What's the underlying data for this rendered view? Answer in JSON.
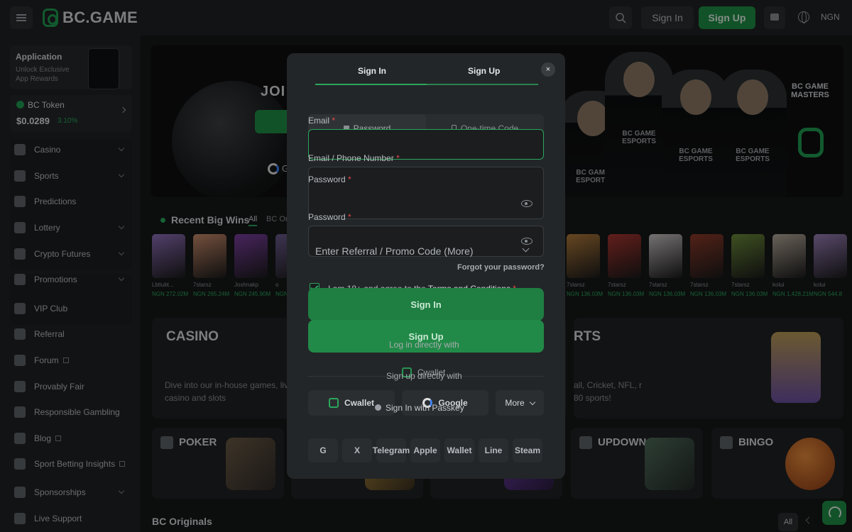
{
  "header": {
    "brand": "BC.GAME",
    "signin_label": "Sign In",
    "signup_label": "Sign Up",
    "currency": "NGN"
  },
  "sidebar": {
    "app_title": "Application",
    "app_sub": "Unlock Exclusive App Rewards",
    "token_name": "BC Token",
    "token_price": "$0.0289",
    "token_change": "3.10%",
    "items": [
      {
        "label": "Casino",
        "icon": "casino-icon",
        "chevron": true
      },
      {
        "label": "Sports",
        "icon": "sports-icon",
        "chevron": true
      },
      {
        "label": "Predictions",
        "icon": "predictions-icon",
        "chevron": false
      },
      {
        "label": "Lottery",
        "icon": "lottery-icon",
        "chevron": true
      },
      {
        "label": "Crypto Futures",
        "icon": "futures-icon",
        "chevron": true
      },
      {
        "label": "Promotions",
        "icon": "gift-icon",
        "chevron": true
      },
      {
        "label": "VIP Club",
        "icon": "crown-icon",
        "chevron": false
      },
      {
        "label": "Referral",
        "icon": "referral-icon",
        "chevron": false
      },
      {
        "label": "Forum",
        "icon": "forum-icon",
        "chevron": false
      },
      {
        "label": "Provably Fair",
        "icon": "shield-icon",
        "chevron": false
      },
      {
        "label": "Responsible Gambling",
        "icon": "people-icon",
        "chevron": false
      },
      {
        "label": "Blog",
        "icon": "blog-icon",
        "chevron": false
      },
      {
        "label": "Sport Betting Insights",
        "icon": "insights-icon",
        "chevron": false
      },
      {
        "label": "Sponsorships",
        "icon": "handshake-icon",
        "chevron": true
      },
      {
        "label": "Live Support",
        "icon": "headset-icon",
        "chevron": false
      }
    ]
  },
  "banner": {
    "join_text": "JOI",
    "google_text": "G",
    "player_label": "BC GAME ESPORTS",
    "masters": "BC GAME MASTERS"
  },
  "wins": {
    "title": "Recent Big Wins",
    "tab_all": "All",
    "tab_originals": "BC Or",
    "left_items": [
      {
        "user": "Lbtiubt...",
        "amount": "NGN 272.02M",
        "color": "#8e6fb8"
      },
      {
        "user": "7starsz",
        "amount": "NGN 265.24M",
        "color": "#c98b6b"
      },
      {
        "user": "Joshnakp",
        "amount": "NGN 245.90M",
        "color": "#7b3fa0"
      },
      {
        "user": "o",
        "amount": "NGN",
        "color": "#6b5b8e"
      }
    ],
    "right_items": [
      {
        "user": "7starsz",
        "amount": "NGN 136.03M",
        "color": "#b07a3a"
      },
      {
        "user": "7starsz",
        "amount": "NGN 136.03M",
        "color": "#a8352f"
      },
      {
        "user": "7starsz",
        "amount": "NGN 136.03M",
        "color": "#c9c3c4"
      },
      {
        "user": "7starsz",
        "amount": "NGN 136.03M",
        "color": "#8d3a2a"
      },
      {
        "user": "7starsz",
        "amount": "NGN 136.03M",
        "color": "#6c8a3a"
      },
      {
        "user": "kolui",
        "amount": "NGN 1,428.21M",
        "color": "#b5a99a"
      },
      {
        "user": "kolui",
        "amount": "NGN 544.8",
        "color": "#9a7fb8"
      }
    ]
  },
  "casino": {
    "title": "CASINO",
    "desc": "Dive into our in-house games, live casino and slots"
  },
  "sports": {
    "title": "RTS",
    "desc": "all, Cricket, NFL, r 80 sports!"
  },
  "tiles": [
    {
      "title": "POKER"
    },
    {
      "title": "UPDOWN"
    },
    {
      "title": "BINGO"
    }
  ],
  "originals": {
    "title": "BC Originals",
    "all": "All"
  },
  "modal": {
    "tab_signin": "Sign In",
    "tab_signup": "Sign Up",
    "close": "×",
    "email_label": "Email",
    "seg_password": "Password",
    "seg_otp": "One-time Code",
    "email_phone_label": "Email / Phone Number",
    "password_label": "Password",
    "password_label2": "Password",
    "referral_placeholder": "Enter Referral / Promo Code (More)",
    "forgot": "Forgot your password?",
    "agree_prefix": "I am 18+ and agree to the",
    "agree_link": "Terms and Conditions",
    "req": "*",
    "signin_btn": "Sign In",
    "signup_btn": "Sign Up",
    "login_direct": "Log in directly with",
    "signup_direct": "Sign up directly with",
    "cwallet": "Cwallet",
    "cwallet_ghost": "Cwallet",
    "google": "Google",
    "google_ghost": "Google",
    "more": "More",
    "passkey": "Sign In with Passkey",
    "socials": [
      "G",
      "X",
      "Telegram",
      "Apple",
      "Wallet",
      "Line",
      "Steam"
    ]
  }
}
